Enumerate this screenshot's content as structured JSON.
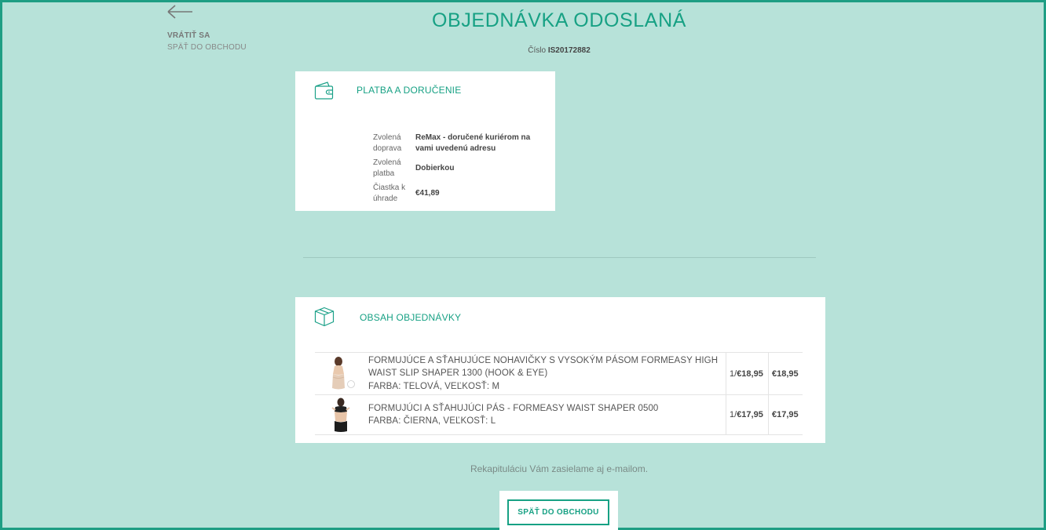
{
  "back": {
    "title": "VRÁTIŤ SA",
    "subtitle": "SPÄŤ DO OBCHODU"
  },
  "header": {
    "title": "OBJEDNÁVKA ODOSLANÁ",
    "order_label": "Číslo",
    "order_number": "IS20172882"
  },
  "shipping_card": {
    "title": "PLATBA A DORUČENIE",
    "icon": "wallet-icon",
    "rows": [
      {
        "label": "Zvolená doprava",
        "value": "ReMax - doručené kuriérom na vami uvedenú adresu"
      },
      {
        "label": "Zvolená platba",
        "value": "Dobierkou"
      },
      {
        "label": "Čiastka k úhrade",
        "value": "€41,89"
      }
    ]
  },
  "order_card": {
    "title": "OBSAH OBJEDNÁVKY",
    "icon": "box-icon",
    "items": [
      {
        "name": "FORMUJÚCE A SŤAHUJÚCE NOHAVIČKY S VYSOKÝM PÁSOM FORMEASY HIGH WAIST SLIP SHAPER 1300 (HOOK & EYE)",
        "variant": "FARBA: TELOVÁ, VEĽKOSŤ: M",
        "qty": "1/",
        "unit_price": "€18,95",
        "total": "€18,95"
      },
      {
        "name": "FORMUJÚCI A SŤAHUJÚCI PÁS - FORMEASY WAIST SHAPER 0500",
        "variant": "FARBA: ČIERNA, VEĽKOSŤ: L",
        "qty": "1/",
        "unit_price": "€17,95",
        "total": "€17,95"
      }
    ]
  },
  "footer": {
    "recap": "Rekapituláciu Vám zasielame aj e-mailom.",
    "button": "SPÄŤ DO OBCHODU"
  },
  "colors": {
    "background": "#b7e2d9",
    "accent": "#17a184"
  }
}
